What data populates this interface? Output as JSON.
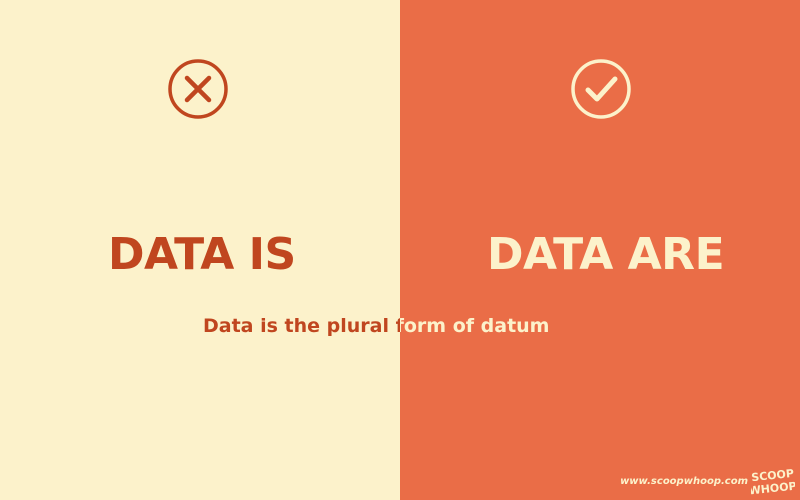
{
  "colors": {
    "left_background": "#FCF2CB",
    "right_background": "#EA6D47",
    "left_accent": "#C0461F",
    "right_accent": "#FCF2CB"
  },
  "left": {
    "icon": "cross-circle-icon",
    "heading": "DATA IS"
  },
  "right": {
    "icon": "check-circle-icon",
    "heading": "DATA ARE"
  },
  "caption": "Data is the plural form of datum",
  "footer": {
    "url": "www.scoopwhoop.com",
    "logo_text": "SCOOP WHOOP"
  }
}
